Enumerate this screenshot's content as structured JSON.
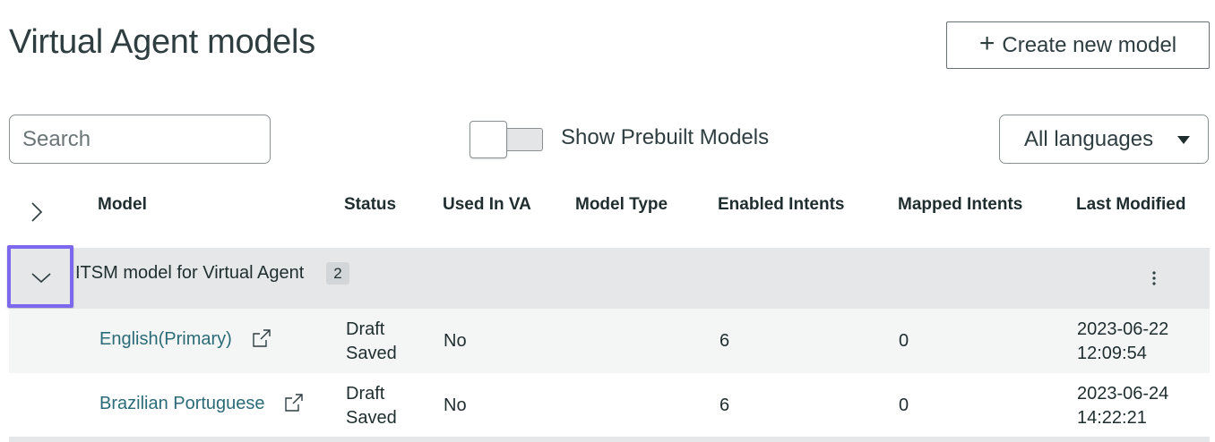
{
  "page": {
    "title": "Virtual Agent models"
  },
  "toolbar": {
    "create_label": "Create new model",
    "search_placeholder": "Search",
    "toggle_label": "Show Prebuilt Models",
    "language_selected": "All languages"
  },
  "table": {
    "columns": [
      "Model",
      "Status",
      "Used In VA",
      "Model Type",
      "Enabled Intents",
      "Mapped Intents",
      "Last Modified"
    ],
    "groups": [
      {
        "name": "ITSM model for Virtual Agent",
        "count": "2",
        "rows": [
          {
            "model": "English(Primary)",
            "status_line1": "Draft",
            "status_line2": "Saved",
            "used_in_va": "No",
            "model_type": "",
            "enabled_intents": "6",
            "mapped_intents": "0",
            "modified_date": "2023-06-22",
            "modified_time": "12:09:54"
          },
          {
            "model": "Brazilian Portuguese",
            "status_line1": "Draft",
            "status_line2": "Saved",
            "used_in_va": "No",
            "model_type": "",
            "enabled_intents": "6",
            "mapped_intents": "0",
            "modified_date": "2023-06-24",
            "modified_time": "14:22:21"
          }
        ]
      }
    ]
  },
  "colors": {
    "link": "#2b6b78",
    "focus_ring": "#7b68ee",
    "group_bg": "#e5e7e8",
    "alt_row_bg": "#f4f5f5"
  }
}
